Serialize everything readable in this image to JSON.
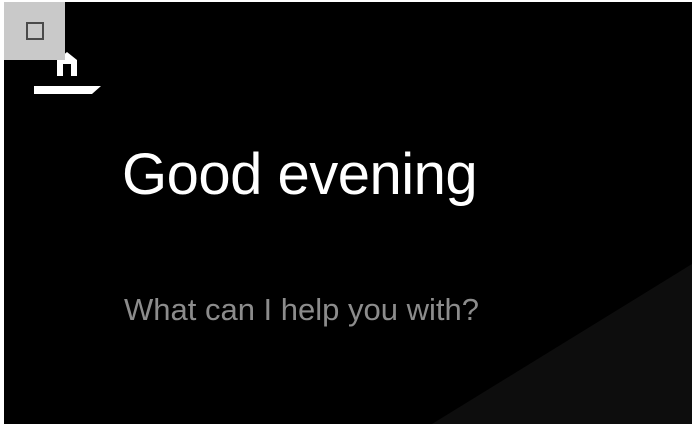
{
  "window_button": {
    "icon": "maximize-square-icon"
  },
  "home": {
    "icon": "home-icon"
  },
  "assistant": {
    "greeting": "Good evening",
    "prompt": "What can I help you with?"
  },
  "colors": {
    "background": "#000000",
    "greeting_text": "#ffffff",
    "prompt_text": "#8c8c8c",
    "window_button_bg": "#c9c9c9"
  }
}
